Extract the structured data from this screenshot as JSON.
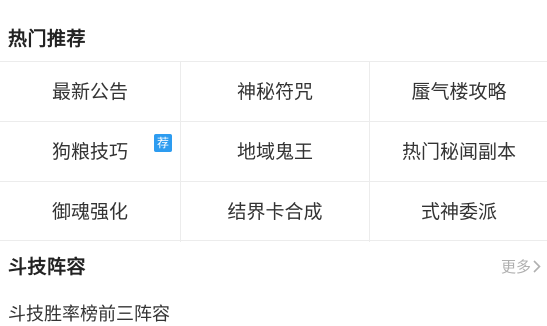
{
  "hot_section": {
    "title": "热门推荐",
    "grid": [
      [
        "最新公告",
        "神秘符咒",
        "蜃气楼攻略"
      ],
      [
        "狗粮技巧",
        "地域鬼王",
        "热门秘闻副本"
      ],
      [
        "御魂强化",
        "结界卡合成",
        "式神委派"
      ]
    ],
    "badge": "荐"
  },
  "arena_section": {
    "title": "斗技阵容",
    "more_label": "更多",
    "items": [
      "斗技胜率榜前三阵容"
    ]
  },
  "colors": {
    "badge_bg": "#2d9cf0",
    "divider": "#ececec",
    "muted_text": "#b0b0b0"
  }
}
